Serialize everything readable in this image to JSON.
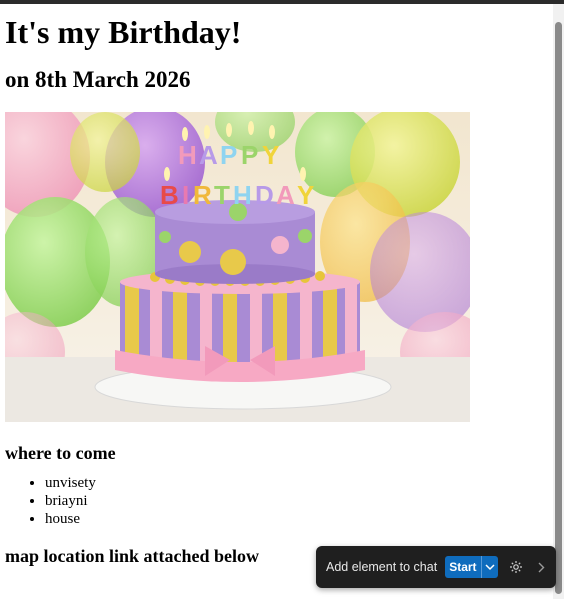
{
  "page": {
    "title": "It's my Birthday!",
    "subtitle": "on 8th March 2026",
    "image_alt": "birthday cake",
    "cake_topper_text": "HAPPY BIRTHDAY",
    "section_heading": "where to come",
    "places": [
      "unvisety",
      "briayni",
      "house"
    ],
    "map_heading": "map location link attached below"
  },
  "toolbar": {
    "label": "Add element to chat",
    "start_label": "Start",
    "icons": [
      "chevron-down-icon",
      "gear-icon",
      "chevron-right-icon"
    ]
  },
  "colors": {
    "toolbar_bg": "#1f1f1f",
    "start_button": "#0f6cbd",
    "cake_purple": "#a78bd6",
    "cake_pink": "#f7b6cc",
    "cake_yellow": "#e8c94a"
  }
}
